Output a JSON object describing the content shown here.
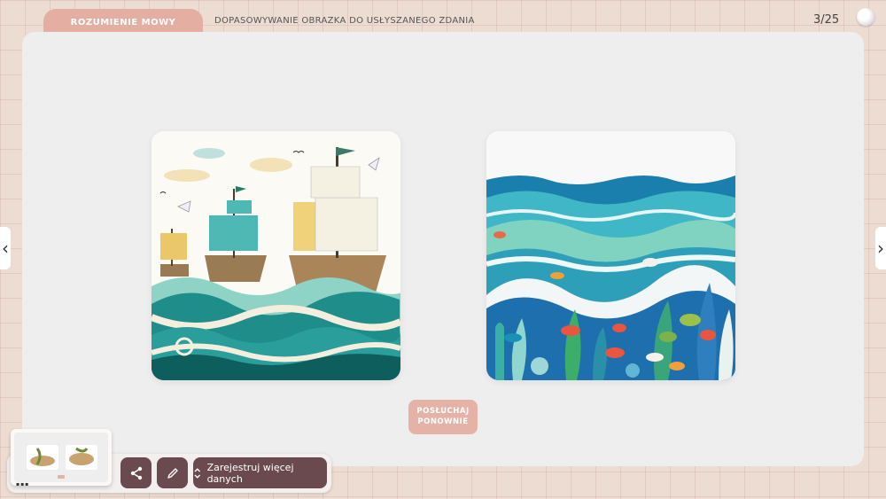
{
  "header": {
    "category": "ROZUMIENIE MOWY",
    "task_title": "DOPASOWYWANIE OBRAZKA DO USŁYSZANEGO ZDANIA",
    "counter": "3/25"
  },
  "options": [
    {
      "name": "ships-picture",
      "icon": "sailing-ships-image"
    },
    {
      "name": "underwater-picture",
      "icon": "underwater-fish-image"
    }
  ],
  "listen_again": {
    "line1": "POSŁUCHAJ",
    "line2": "PONOWNIE"
  },
  "toolbar": {
    "share_icon": "share-icon",
    "edit_icon": "pencil-icon",
    "register_label": "Zarejestruj więcej danych",
    "dots": "▪▪▪"
  },
  "colors": {
    "accent": "#e4aea3",
    "toolbar_button": "#6b4a4f",
    "panel": "#efeeef"
  }
}
